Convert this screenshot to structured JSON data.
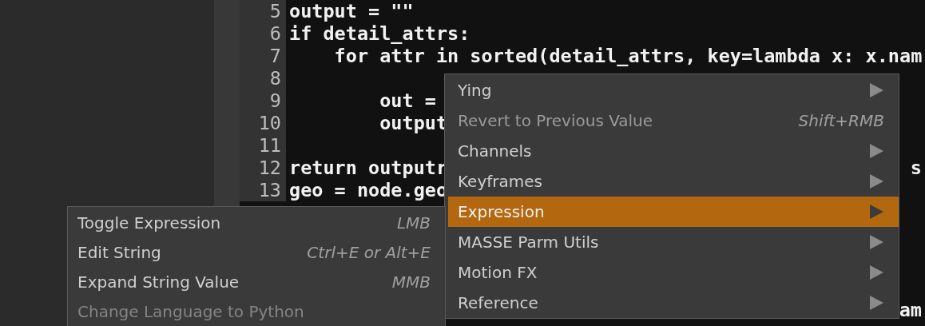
{
  "editor": {
    "lines": [
      {
        "number": "5",
        "code": "output = \"\""
      },
      {
        "number": "6",
        "code": "if detail_attrs:"
      },
      {
        "number": "7",
        "code": "    for attr in sorted(detail_attrs, key=lambda x: x.nam"
      },
      {
        "number": "8"
      },
      {
        "number": "9",
        "code": "        out ="
      },
      {
        "number": "10",
        "code": "        output"
      },
      {
        "number": "11"
      },
      {
        "number": "12",
        "code": "return outputr",
        "tail": "s"
      },
      {
        "number": "13",
        "code": "geo = node.geo"
      },
      {
        "tail": "am"
      }
    ]
  },
  "context_menu": {
    "items": [
      {
        "label": "Ying",
        "submenu": true,
        "disabled": false,
        "selected": false
      },
      {
        "label": "Revert to Previous Value",
        "shortcut": "Shift+RMB",
        "submenu": false,
        "disabled": true,
        "selected": false
      },
      {
        "label": "Channels",
        "submenu": true,
        "disabled": false,
        "selected": false
      },
      {
        "label": "Keyframes",
        "submenu": true,
        "disabled": false,
        "selected": false
      },
      {
        "label": "Expression",
        "submenu": true,
        "disabled": false,
        "selected": true
      },
      {
        "label": "MASSE Parm Utils",
        "submenu": true,
        "disabled": false,
        "selected": false
      },
      {
        "label": "Motion FX",
        "submenu": true,
        "disabled": false,
        "selected": false
      },
      {
        "label": "Reference",
        "submenu": true,
        "disabled": false,
        "selected": false
      }
    ]
  },
  "submenu": {
    "items": [
      {
        "label": "Toggle Expression",
        "shortcut": "LMB",
        "disabled": false
      },
      {
        "label": "Edit String",
        "shortcut": "Ctrl+E or Alt+E",
        "disabled": false
      },
      {
        "label": "Expand String Value",
        "shortcut": "MMB",
        "disabled": false
      },
      {
        "label": "Change Language to Python",
        "disabled": true
      }
    ]
  }
}
